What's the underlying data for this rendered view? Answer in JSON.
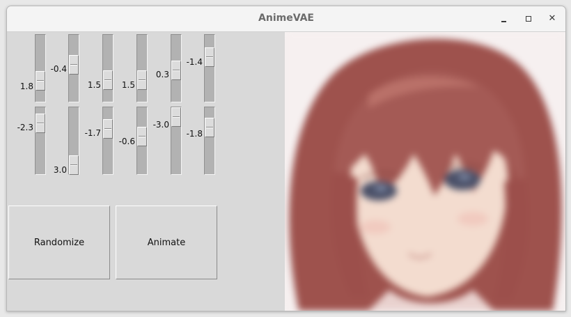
{
  "window": {
    "title": "AnimeVAE"
  },
  "sliders": [
    {
      "value": "1.8",
      "level": 0.7
    },
    {
      "value": "-0.4",
      "level": 0.35
    },
    {
      "value": "1.5",
      "level": 0.62
    },
    {
      "value": "1.5",
      "level": 0.62
    },
    {
      "value": "0.3",
      "level": 0.45
    },
    {
      "value": "-1.4",
      "level": 0.2
    },
    {
      "value": "-2.3",
      "level": 0.12
    },
    {
      "value": "3.0",
      "level": 0.85
    },
    {
      "value": "-1.7",
      "level": 0.18
    },
    {
      "value": "-0.6",
      "level": 0.33
    },
    {
      "value": "-3.0",
      "level": 0.0
    },
    {
      "value": "-1.8",
      "level": 0.17
    }
  ],
  "buttons": {
    "randomize": "Randomize",
    "animate": "Animate"
  },
  "colors": {
    "hair": "#a45a55",
    "skin": "#f2ddd0",
    "eyes": "#4a5068",
    "background": "#f7f2f2"
  }
}
